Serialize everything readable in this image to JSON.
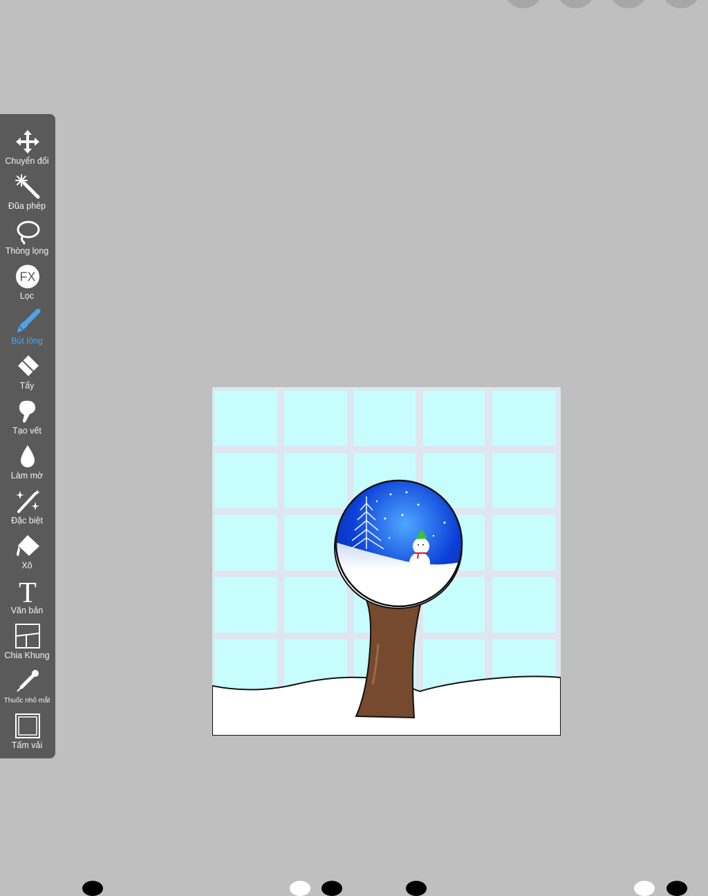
{
  "app": {
    "background": "#bfbfbf",
    "toolbar_color": "#5a5a5a",
    "active_color": "#4da3ee"
  },
  "toolbar": {
    "items": [
      {
        "id": "transform",
        "label": "Chuyển đổi",
        "icon": "move-arrows-icon",
        "active": false
      },
      {
        "id": "magic-wand",
        "label": "Đũa phép",
        "icon": "magic-wand-icon",
        "active": false
      },
      {
        "id": "lasso",
        "label": "Thòng lọng",
        "icon": "lasso-icon",
        "active": false
      },
      {
        "id": "filter",
        "label": "Lọc",
        "icon": "fx-icon",
        "active": false,
        "icon_text": "FX"
      },
      {
        "id": "brush",
        "label": "Bút lông",
        "icon": "brush-icon",
        "active": true
      },
      {
        "id": "eraser",
        "label": "Tẩy",
        "icon": "eraser-icon",
        "active": false
      },
      {
        "id": "smudge",
        "label": "Tạo vết",
        "icon": "smudge-icon",
        "active": false
      },
      {
        "id": "blur",
        "label": "Làm mờ",
        "icon": "droplet-icon",
        "active": false
      },
      {
        "id": "special",
        "label": "Đặc biệt",
        "icon": "sparkle-wand-icon",
        "active": false
      },
      {
        "id": "bucket",
        "label": "Xô",
        "icon": "paint-bucket-icon",
        "active": false
      },
      {
        "id": "text",
        "label": "Văn bản",
        "icon": "text-icon",
        "active": false,
        "icon_text": "T"
      },
      {
        "id": "frame-divider",
        "label": "Chia Khung",
        "icon": "frame-divider-icon",
        "active": false
      },
      {
        "id": "eyedropper",
        "label": "Thuốc nhỏ mắt",
        "icon": "eyedropper-icon",
        "active": false
      },
      {
        "id": "canvas",
        "label": "Tấm vải",
        "icon": "canvas-icon",
        "active": false
      }
    ]
  },
  "artwork": {
    "description_free": true,
    "colors": {
      "tile": "#c7fdfd",
      "grid": "#dfe6ef",
      "snow": "#ffffff",
      "trunk": "#764a2e",
      "globe_blue": "#0b3fd8"
    }
  }
}
